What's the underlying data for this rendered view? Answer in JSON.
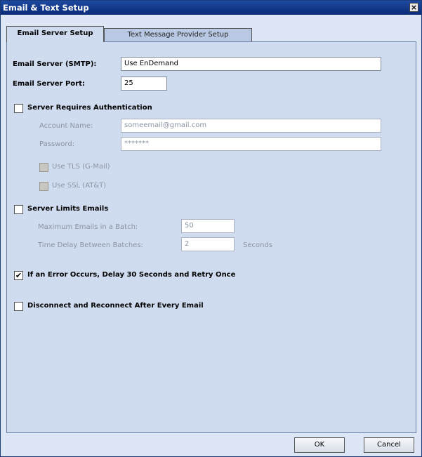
{
  "window": {
    "title": "Email & Text Setup"
  },
  "tabs": [
    {
      "label": "Email Server Setup"
    },
    {
      "label": "Text Message Provider Setup"
    }
  ],
  "server": {
    "smtp_label": "Email Server (SMTP):",
    "smtp_value": "Use EnDemand",
    "port_label": "Email Server Port:",
    "port_value": "25"
  },
  "auth": {
    "label": "Server Requires Authentication",
    "checked": false,
    "account_label": "Account Name:",
    "account_value": "someemail@gmail.com",
    "password_label": "Password:",
    "password_value": "*******",
    "tls_label": "Use TLS (G-Mail)",
    "ssl_label": "Use SSL (AT&T)"
  },
  "limits": {
    "label": "Server Limits Emails",
    "checked": false,
    "max_label": "Maximum Emails in a Batch:",
    "max_value": "50",
    "delay_label": "Time Delay Between Batches:",
    "delay_value": "2",
    "delay_unit": "Seconds"
  },
  "retry": {
    "label": "If an Error Occurs, Delay 30 Seconds and Retry Once",
    "checked": true,
    "mark": "✔"
  },
  "reconnect": {
    "label": "Disconnect and Reconnect After Every Email",
    "checked": false
  },
  "buttons": {
    "ok": "OK",
    "cancel": "Cancel"
  },
  "icons": {
    "close": "close-icon",
    "check": "check-icon"
  }
}
